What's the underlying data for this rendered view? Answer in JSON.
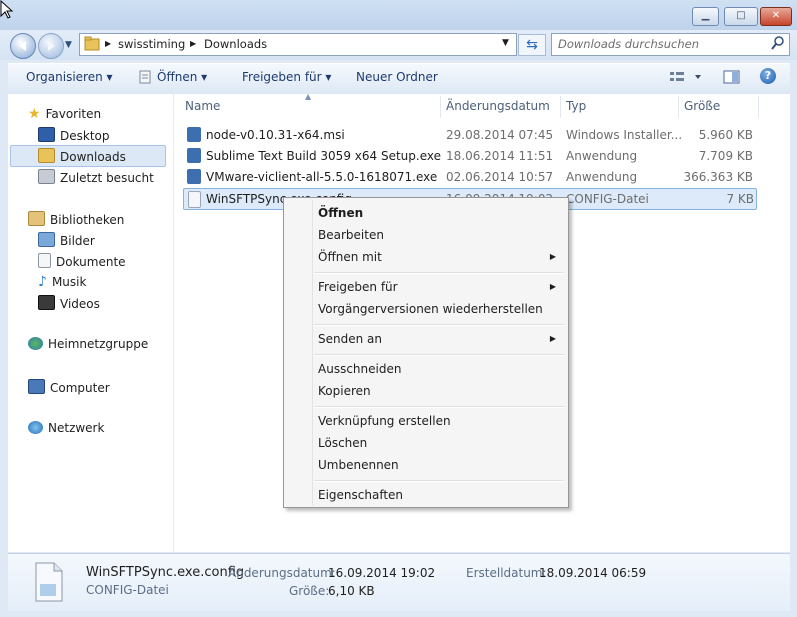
{
  "window": {
    "minimize": "▁",
    "maximize": "□",
    "close": "✕"
  },
  "address": {
    "crumbs": [
      "swisstiming",
      "Downloads"
    ],
    "search_placeholder": "Downloads durchsuchen"
  },
  "toolbar": {
    "organize": "Organisieren ▾",
    "open": "Öffnen ▾",
    "share": "Freigeben für ▾",
    "new_folder": "Neuer Ordner",
    "help": "?"
  },
  "sidebar": {
    "favorites": "Favoriten",
    "desktop": "Desktop",
    "downloads": "Downloads",
    "recent": "Zuletzt besucht",
    "libraries": "Bibliotheken",
    "pictures": "Bilder",
    "documents": "Dokumente",
    "music": "Musik",
    "videos": "Videos",
    "homegroup": "Heimnetzgruppe",
    "computer": "Computer",
    "network": "Netzwerk"
  },
  "columns": {
    "name": "Name",
    "modified": "Änderungsdatum",
    "type": "Typ",
    "size": "Größe"
  },
  "files": [
    {
      "name": "node-v0.10.31-x64.msi",
      "modified": "29.08.2014 07:45",
      "type": "Windows Installer...",
      "size": "5.960 KB",
      "color": "#3d6fb0"
    },
    {
      "name": "Sublime Text Build 3059 x64 Setup.exe",
      "modified": "18.06.2014 11:51",
      "type": "Anwendung",
      "size": "7.709 KB",
      "color": "#3d6fb0"
    },
    {
      "name": "VMware-viclient-all-5.5.0-1618071.exe",
      "modified": "02.06.2014 10:57",
      "type": "Anwendung",
      "size": "366.363 KB",
      "color": "#3d6fb0"
    },
    {
      "name": "WinSFTPSync.exe.config",
      "modified": "16.09.2014 19:02",
      "type": "CONFIG-Datei",
      "size": "7 KB",
      "color": "#9aa7b8"
    }
  ],
  "context_menu": {
    "open": "Öffnen",
    "edit": "Bearbeiten",
    "open_with": "Öffnen mit",
    "share_with": "Freigeben für",
    "restore": "Vorgängerversionen wiederherstellen",
    "send_to": "Senden an",
    "cut": "Ausschneiden",
    "copy": "Kopieren",
    "shortcut": "Verknüpfung erstellen",
    "delete": "Löschen",
    "rename": "Umbenennen",
    "properties": "Eigenschaften"
  },
  "details": {
    "filename": "WinSFTPSync.exe.config",
    "filetype": "CONFIG-Datei",
    "modified_label": "Änderungsdatum:",
    "modified_value": "16.09.2014 19:02",
    "created_label": "Erstelldatum:",
    "created_value": "18.09.2014 06:59",
    "size_label": "Größe:",
    "size_value": "6,10 KB"
  }
}
